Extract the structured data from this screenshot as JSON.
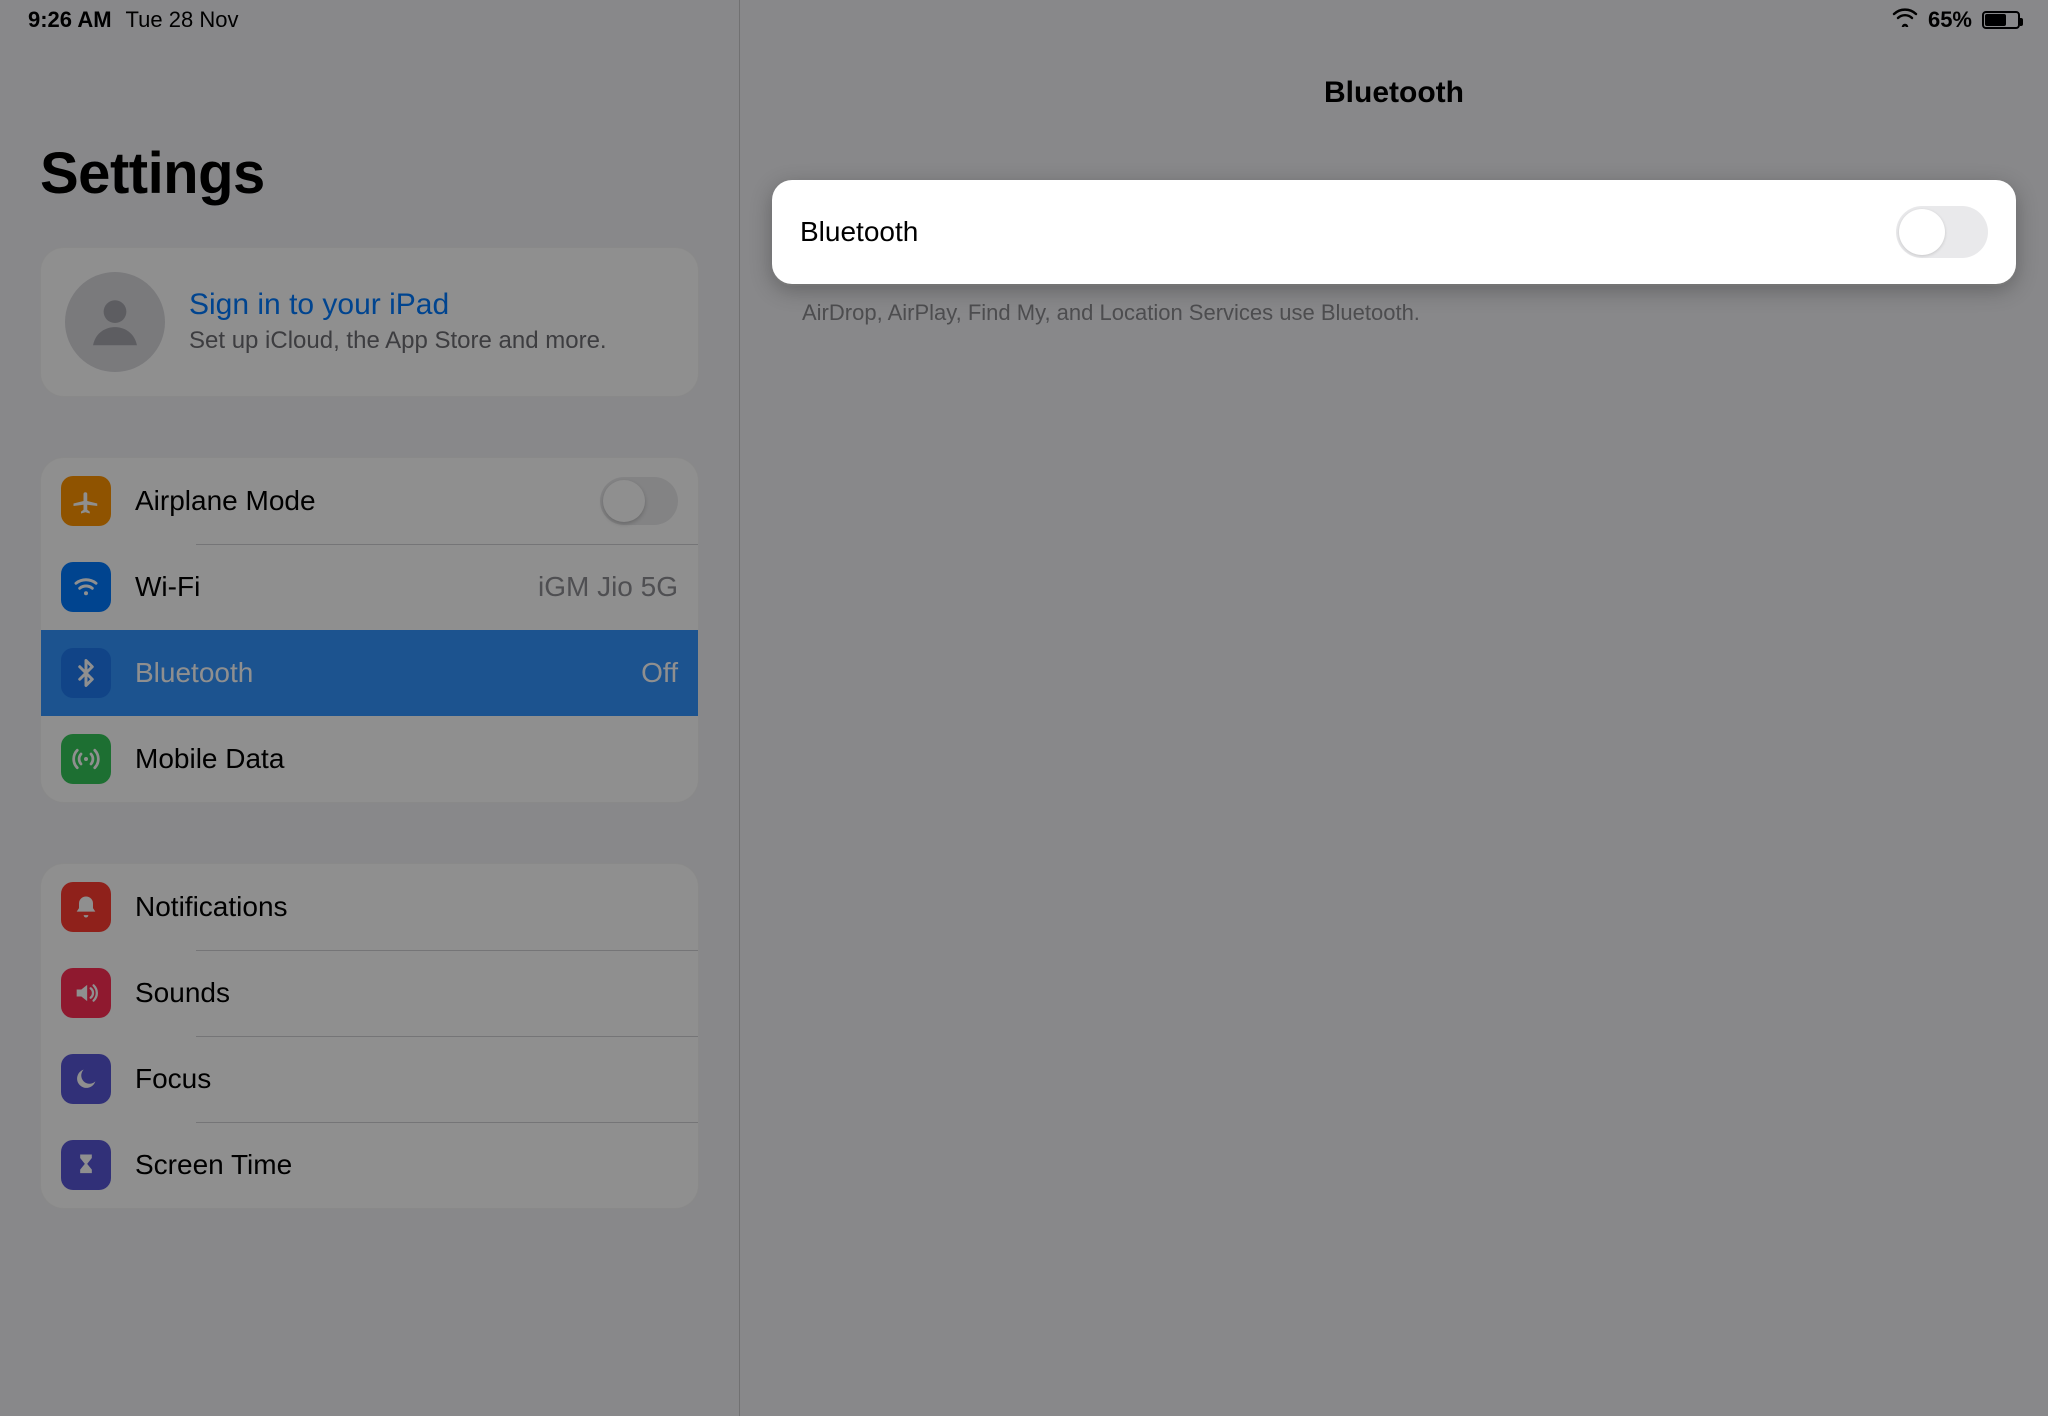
{
  "status": {
    "time": "9:26 AM",
    "date": "Tue 28 Nov",
    "battery_pct": "65%"
  },
  "sidebar": {
    "title": "Settings",
    "signin": {
      "title": "Sign in to your iPad",
      "subtitle": "Set up iCloud, the App Store and more."
    },
    "group1": {
      "airplane": "Airplane Mode",
      "wifi": "Wi-Fi",
      "wifi_value": "iGM Jio 5G",
      "bluetooth": "Bluetooth",
      "bluetooth_value": "Off",
      "mobile": "Mobile Data"
    },
    "group2": {
      "notifications": "Notifications",
      "sounds": "Sounds",
      "focus": "Focus",
      "screentime": "Screen Time"
    }
  },
  "detail": {
    "title": "Bluetooth",
    "row_label": "Bluetooth",
    "footer": "AirDrop, AirPlay, Find My, and Location Services use Bluetooth."
  }
}
